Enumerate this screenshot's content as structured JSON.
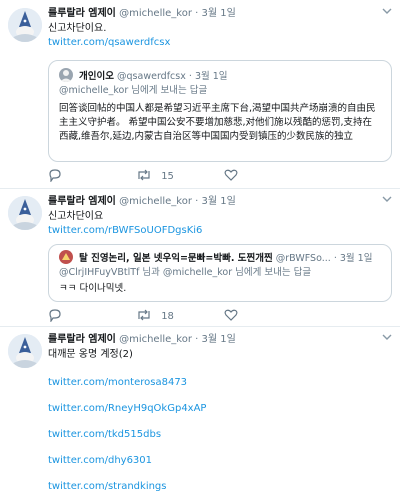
{
  "tweets": [
    {
      "name": "룰루랄라 엠제이",
      "handle": "@michelle_kor",
      "dot": "·",
      "time": "3월 1일",
      "text": "신고차단이요.",
      "link": "twitter.com/qsawerdfcsx",
      "quote": {
        "name": "개인이오",
        "handle": "@qsawerdfcsx",
        "dot": "·",
        "time": "3월 1일",
        "reply_prefix": "@michelle_kor 님에게 보내는 답글",
        "body": "回答谈回帖的中国人都是希望习近平主席下台,渴望中国共产场崩溃的自由民主主义守护者。 希望中国公安不要增加慈悲,对他们施以残酷的惩罚,支持在西藏,维吾尔,延边,内蒙古自治区等中国国内受到镇压的少数民族的独立"
      },
      "actions": {
        "reply": "",
        "retweet": "15",
        "like": ""
      }
    },
    {
      "name": "룰루랄라 엠제이",
      "handle": "@michelle_kor",
      "dot": "·",
      "time": "3월 1일",
      "text": "신고차단이요",
      "link": "twitter.com/rBWFSoUOFDgsKi6",
      "quote": {
        "name": "탈 진영논리, 일본 넷우익=문빠=박빠. 도찐개찐",
        "handle": "@rBWFSo...",
        "dot": "·",
        "time": "3월 1일",
        "reply_prefix": "@ClrjIHFuyVBtlTf 님과 @michelle_kor 님에게 보내는 답글",
        "body": "ㅋㅋ 다이나믹넷."
      },
      "actions": {
        "reply": "",
        "retweet": "18",
        "like": ""
      }
    },
    {
      "name": "룰루랄라 엠제이",
      "handle": "@michelle_kor",
      "dot": "·",
      "time": "3월 1일",
      "text": "대깨문 옹명 계정(2)",
      "links": [
        "twitter.com/monterosa8473",
        "twitter.com/RneyH9qOkGp4xAP",
        "twitter.com/tkd515dbs",
        "twitter.com/dhy6301",
        "twitter.com/strandkings"
      ]
    }
  ],
  "icons": [
    "caret-down-icon",
    "reply-icon",
    "retweet-icon",
    "like-icon"
  ],
  "colors": {
    "link": "#1b95e0",
    "secondary": "#657786",
    "border": "#ccd6dd"
  }
}
